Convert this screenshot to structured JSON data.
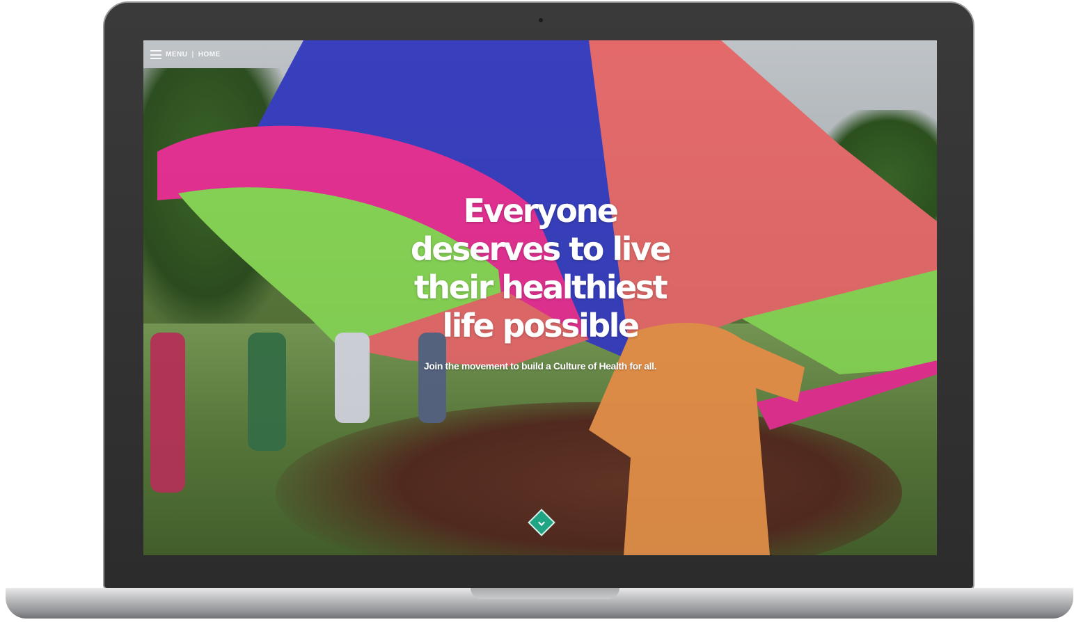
{
  "nav": {
    "menu_label": "MENU",
    "separator": "|",
    "home_label": "HOME",
    "menu_icon": "hamburger-icon"
  },
  "hero": {
    "title_lines": [
      "Everyone",
      "deserves to live",
      "their healthiest",
      "life possible"
    ],
    "subtitle": "Join the movement to build a Culture of Health for all."
  },
  "scroll_button": {
    "icon": "chevron-down-icon",
    "color": "#1fa583"
  },
  "colors": {
    "parachute_blue": "#3b43c8",
    "parachute_pink": "#f0349a",
    "parachute_green": "#8ee05a",
    "parachute_coral": "#f07070",
    "text": "#ffffff"
  }
}
